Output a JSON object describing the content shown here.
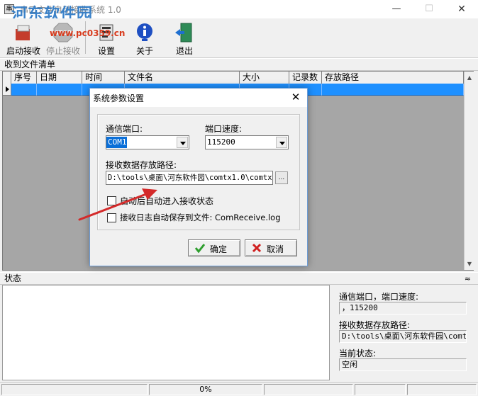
{
  "window": {
    "title": "串口文件自动接收系统 1.0",
    "watermark": "河东软件园",
    "watermark_url": "www.pc0359.cn",
    "controls": {
      "minimize": "—",
      "maximize": "☐",
      "close": "✕"
    }
  },
  "toolbar": {
    "start_receive": "启动接收",
    "stop_receive": "停止接收",
    "stop_badge": "STOP",
    "settings": "设置",
    "about": "关于",
    "exit": "退出"
  },
  "file_list": {
    "caption": "收到文件清单",
    "columns": [
      "序号",
      "日期",
      "时间",
      "文件名",
      "大小",
      "记录数",
      "存放路径"
    ]
  },
  "status_panel": {
    "caption": "状态",
    "collapse_glyph": "≈"
  },
  "info_panel": {
    "port_speed_label": "通信端口，端口速度:",
    "port_speed_value": "，115200",
    "path_label": "接收数据存放路径:",
    "path_value": "D:\\tools\\桌面\\河东软件园\\comt",
    "state_label": "当前状态:",
    "state_value": "空闲"
  },
  "statusbar": {
    "progress_text": "0%",
    "progress_fraction": 0
  },
  "dialog": {
    "title": "系统参数设置",
    "close_glyph": "✕",
    "port_label": "通信端口:",
    "port_value": "COM1",
    "speed_label": "端口速度:",
    "speed_value": "115200",
    "path_label": "接收数据存放路径:",
    "path_value": "D:\\tools\\桌面\\河东软件园\\comtx1.0\\comtx",
    "browse_glyph": "...",
    "auto_start_label": "启动后自动进入接收状态",
    "auto_start_checked": false,
    "auto_log_label": "接收日志自动保存到文件: ComReceive.log",
    "auto_log_checked": false,
    "ok_label": "确定",
    "cancel_label": "取消"
  },
  "colors": {
    "selection": "#1e90ff",
    "ok_check": "#2e9e2e",
    "cancel_x": "#d02020",
    "annotation_arrow": "#d42a2a"
  }
}
